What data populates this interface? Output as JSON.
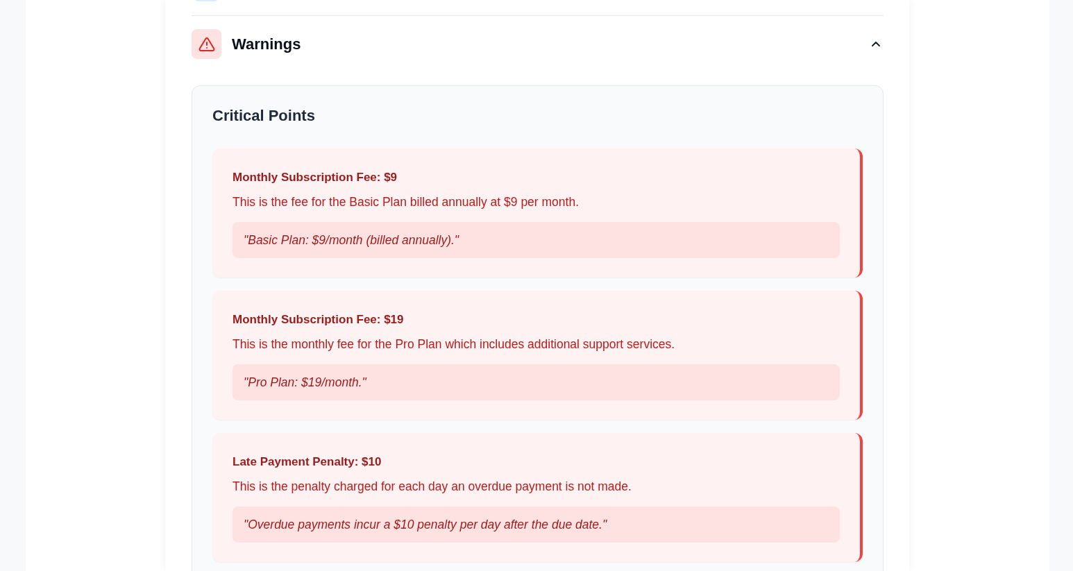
{
  "sections": [
    {
      "kind": "warnings",
      "title": "Warnings",
      "expanded": true,
      "panel": {
        "title": "Critical Points",
        "items": [
          {
            "title": "Monthly Subscription Fee: $9",
            "description": "This is the fee for the Basic Plan billed annually at $9 per month.",
            "quote": "\"Basic Plan: $9/month (billed annually).\""
          },
          {
            "title": "Monthly Subscription Fee: $19",
            "description": "This is the monthly fee for the Pro Plan which includes additional support services.",
            "quote": "\"Pro Plan: $19/month.\""
          },
          {
            "title": "Late Payment Penalty: $10",
            "description": "This is the penalty charged for each day an overdue payment is not made.",
            "quote": "\"Overdue payments incur a $10 penalty per day after the due date.\""
          }
        ]
      }
    }
  ]
}
